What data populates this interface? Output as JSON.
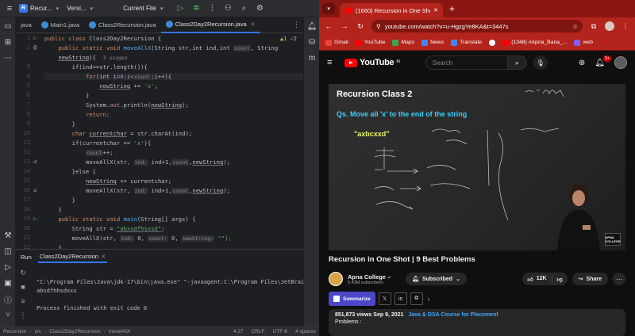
{
  "ide": {
    "top": {
      "project_badge": "R",
      "project_name": "Recur...",
      "vcs": "Versi...",
      "current_file": "Current File"
    },
    "tabs": [
      {
        "label": "java"
      },
      {
        "label": "Main1.java"
      },
      {
        "label": "Class2Recursion.java"
      },
      {
        "label": "Class2Day2Recursion.java"
      }
    ],
    "inspection": {
      "warnings": "1",
      "weak": "2"
    },
    "code": {
      "l1_kw": "public class ",
      "l1_name": "Class2Day2Recursion {",
      "l2_kw": "public static void ",
      "l2_fn": "moveAllX",
      "l2_rest": "(String str,int ind,int ",
      "l2_count": "count",
      "l2_rest2": ", String",
      "l3_param": "newString",
      "l3_rest": "){",
      "l3_usages": "3 usages",
      "l4": "if(ind==str.length()){",
      "l5_kw": "for",
      "l5_a": "(int i=",
      "l5_b": "0",
      "l5_c": ";i<",
      "l5_count": "count",
      "l5_d": ";i++){",
      "l6_var": "newString",
      "l6_op": " += ",
      "l6_str": "'x'",
      "l6_end": ";",
      "l7": "}",
      "l8_a": "System.",
      "l8_out": "out",
      "l8_b": ".println(",
      "l8_var": "newString",
      "l8_c": ");",
      "l9": "return;",
      "l10": "}",
      "l11_a": "char ",
      "l11_var": "currentchar",
      "l11_b": " = str.charAt(ind);",
      "l12_a": "if(currentchar == ",
      "l12_str": "'x'",
      "l12_b": "){",
      "l13_var": "count",
      "l13_b": "++;",
      "l14_fn": "moveAllX",
      "l14_a": "(str, ",
      "l14_hint": "ind:",
      "l14_b": " ind+1,",
      "l14_count": "count",
      "l14_c": ",",
      "l14_var": "newString",
      "l14_d": ");",
      "l15": "}else {",
      "l16_var": "newString",
      "l16_b": " += currentchar;",
      "l17_fn": "moveAllX",
      "l17_a": "(str, ",
      "l17_hint": "ind:",
      "l17_b": " ind+1,",
      "l17_count": "count",
      "l17_c": ",",
      "l17_var": "newString",
      "l17_d": ");",
      "l18": "}",
      "l19": "}",
      "l20_kw": "public static void ",
      "l20_fn": "main",
      "l20_rest": "(String[] args) {",
      "l21_a": "String str = ",
      "l21_str": "\"abxsdfhsxsd\"",
      "l21_b": ";",
      "l22_fn": "moveAllX",
      "l22_a": "(str, ",
      "l22_h1": "ind:",
      "l22_b": " 0, ",
      "l22_h2": "count:",
      "l22_c": " 0, ",
      "l22_h3": "newString:",
      "l22_d": " \"\");",
      "l23": "}"
    },
    "run": {
      "label": "Run",
      "config": "Class2Day2Recursion",
      "cmd": "\"C:\\Program Files\\Java\\jdk-17\\bin\\java.exe\" \"-javaagent:C:\\Program Files\\JetBrai",
      "out": "absdfhhsdxxx",
      "exit": "Process finished with exit code 0"
    },
    "status": {
      "c1": "Recursion",
      "c2": "src",
      "c3": "Class2Day2Recursion",
      "c4": "moveAllX",
      "pos": "4:27",
      "eol": "CRLF",
      "enc": "UTF-8",
      "indent": "4 spaces"
    }
  },
  "browser": {
    "tab_title": "(1660) Recursion in One Sho",
    "url": "youtube.com/watch?v=u-HgzgYe8KA&t=3447s",
    "bookmarks": [
      {
        "label": "Gmail",
        "color": "#ea4335"
      },
      {
        "label": "YouTube",
        "color": "#ff0000"
      },
      {
        "label": "Maps",
        "color": "#34a853"
      },
      {
        "label": "News",
        "color": "#4285f4"
      },
      {
        "label": "Translate",
        "color": "#4285f4"
      },
      {
        "label": "",
        "color": "#ffffff"
      },
      {
        "label": "(1348) #Apna_Bana_...",
        "color": "#ff0000"
      },
      {
        "label": "web",
        "color": "#7b61ff"
      }
    ],
    "yt": {
      "logo": "YouTube",
      "region": "IN",
      "search_placeholder": "Search",
      "notif_count": "9+",
      "video": {
        "board_title": "Recursion Class 2",
        "question": "Qs. Move all 'x' to the end of the string",
        "sample": "\"axbcxxd\"",
        "logo": "APNA COLLEGE"
      },
      "title": "Recursion in One Shot | 9 Best Problems",
      "channel": "Apna College",
      "subs": "5.43M subscribers",
      "subscribed": "Subscribed",
      "likes": "12K",
      "share": "Share",
      "summarize": "Summarize",
      "views": "851,873 views",
      "date": "Sep 9, 2021",
      "course_link": "Java & DSA Course for Placement",
      "problems": "Problems :"
    }
  }
}
